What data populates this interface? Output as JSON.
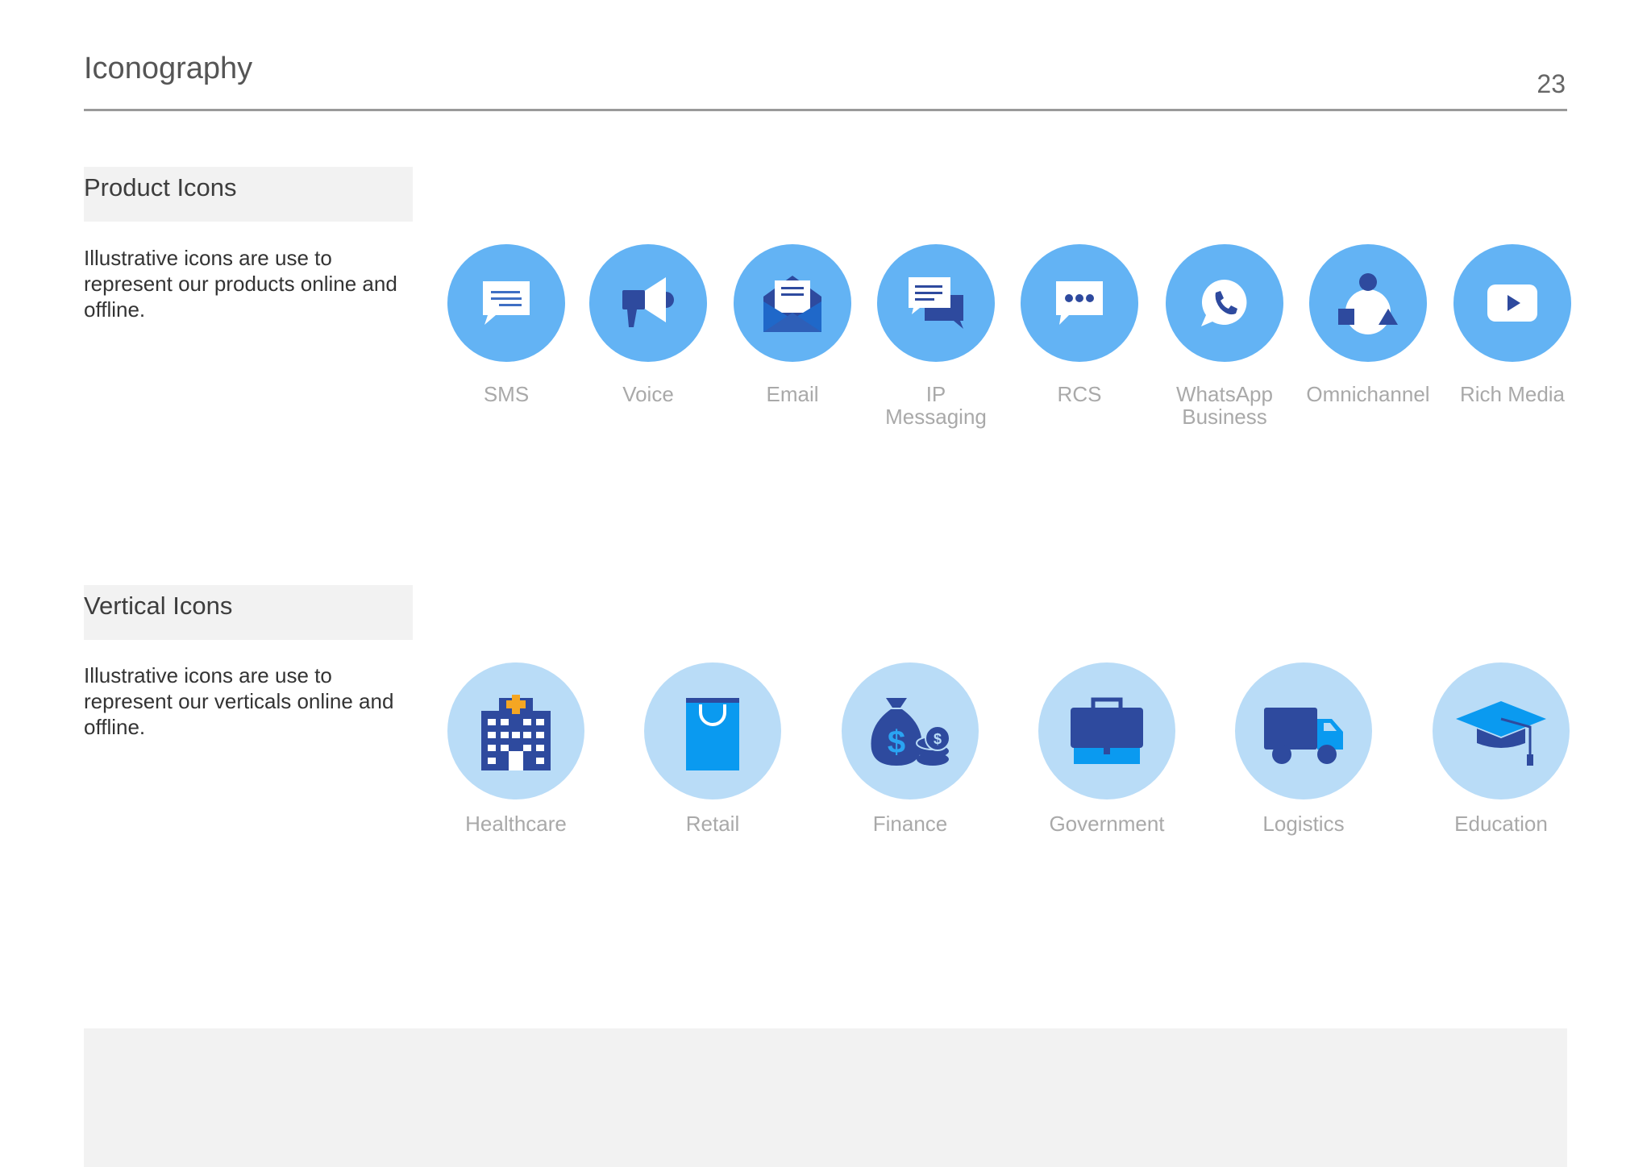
{
  "header": {
    "title": "Iconography",
    "page_number": "23"
  },
  "product_section": {
    "title": "Product Icons",
    "description": "Illustrative icons are use to represent our products online and offline.",
    "icons": [
      {
        "label": "SMS",
        "icon": "sms-icon"
      },
      {
        "label": "Voice",
        "icon": "megaphone-icon"
      },
      {
        "label": "Email",
        "icon": "envelope-icon"
      },
      {
        "label": "IP\nMessaging",
        "icon": "chat-bubbles-icon"
      },
      {
        "label": "RCS",
        "icon": "rcs-chat-icon"
      },
      {
        "label": "WhatsApp\nBusiness",
        "icon": "whatsapp-icon"
      },
      {
        "label": "Omnichannel",
        "icon": "shapes-icon"
      },
      {
        "label": "Rich Media",
        "icon": "play-icon"
      }
    ]
  },
  "vertical_section": {
    "title": "Vertical Icons",
    "description": "Illustrative icons are use to represent our verticals online and offline.",
    "icons": [
      {
        "label": "Healthcare",
        "icon": "hospital-icon"
      },
      {
        "label": "Retail",
        "icon": "shopping-bag-icon"
      },
      {
        "label": "Finance",
        "icon": "money-bag-icon"
      },
      {
        "label": "Government",
        "icon": "briefcase-icon"
      },
      {
        "label": "Logistics",
        "icon": "truck-icon"
      },
      {
        "label": "Education",
        "icon": "graduation-cap-icon"
      }
    ]
  },
  "colors": {
    "product_circle": "#63b3f4",
    "vertical_circle": "#b9dcf7",
    "icon_dark": "#2e4a9e",
    "icon_bright": "#0a9af0",
    "accent_orange": "#f5a623"
  }
}
